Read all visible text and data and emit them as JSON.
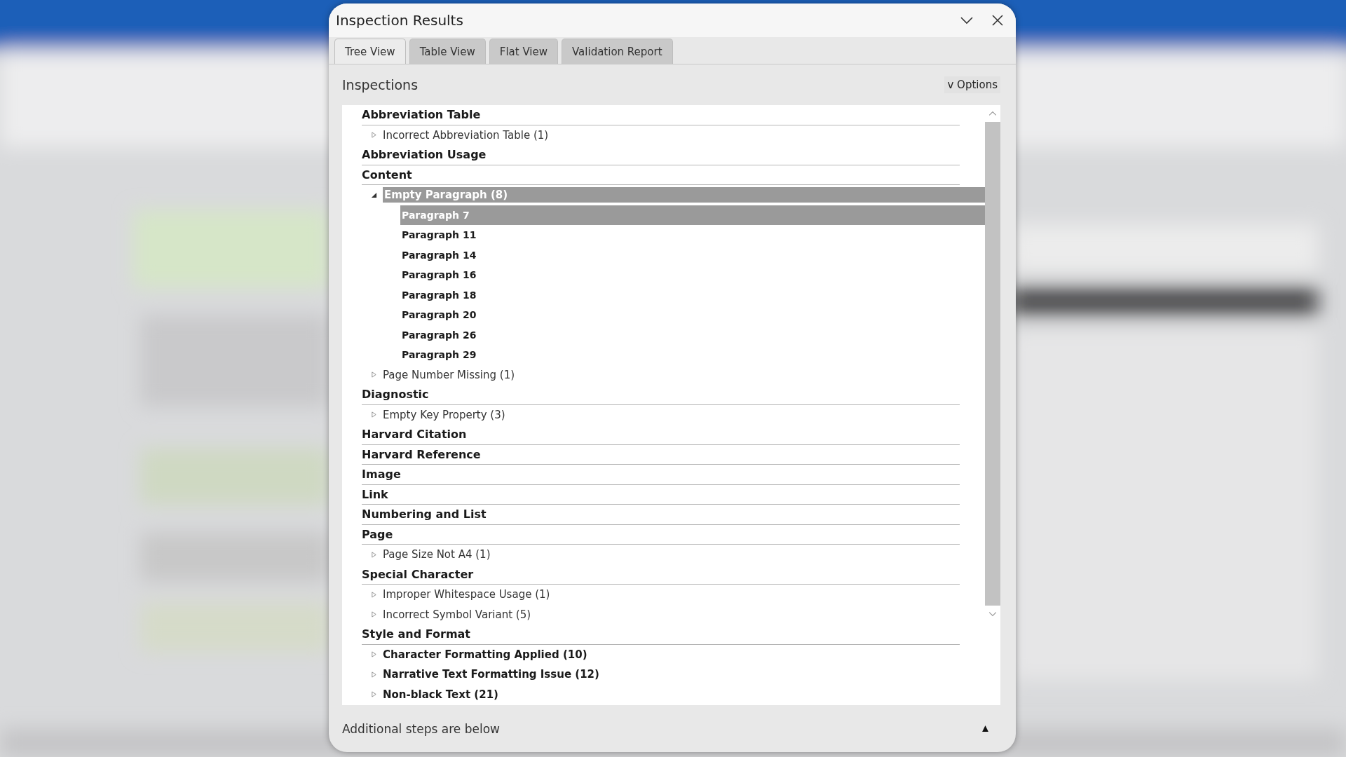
{
  "window": {
    "title": "Inspection Results"
  },
  "tabs": [
    {
      "label": "Tree View",
      "selected": true
    },
    {
      "label": "Table View",
      "selected": false
    },
    {
      "label": "Flat View",
      "selected": false
    },
    {
      "label": "Validation Report",
      "selected": false
    }
  ],
  "panel": {
    "title": "Inspections",
    "options_button": "v Options"
  },
  "categories": [
    {
      "label": "Abbreviation Table",
      "children": [
        {
          "label": "Incorrect Abbreviation Table (1)",
          "expanded": false,
          "emphasized": false,
          "selected": false
        }
      ]
    },
    {
      "label": "Abbreviation Usage"
    },
    {
      "label": "Content",
      "children": [
        {
          "label": "Empty Paragraph (8)",
          "expanded": true,
          "emphasized": true,
          "selected": true,
          "children": [
            {
              "label": "Paragraph 7",
              "selected": true
            },
            {
              "label": "Paragraph 11",
              "selected": false
            },
            {
              "label": "Paragraph 14",
              "selected": false
            },
            {
              "label": "Paragraph 16",
              "selected": false
            },
            {
              "label": "Paragraph 18",
              "selected": false
            },
            {
              "label": "Paragraph 20",
              "selected": false
            },
            {
              "label": "Paragraph 26",
              "selected": false
            },
            {
              "label": "Paragraph 29",
              "selected": false
            }
          ]
        },
        {
          "label": "Page Number Missing (1)",
          "expanded": false,
          "emphasized": false,
          "selected": false
        }
      ]
    },
    {
      "label": "Diagnostic",
      "children": [
        {
          "label": "Empty Key Property (3)",
          "expanded": false,
          "emphasized": false,
          "selected": false
        }
      ]
    },
    {
      "label": "Harvard Citation"
    },
    {
      "label": "Harvard Reference"
    },
    {
      "label": "Image"
    },
    {
      "label": "Link"
    },
    {
      "label": "Numbering and List"
    },
    {
      "label": "Page",
      "children": [
        {
          "label": "Page Size Not A4 (1)",
          "expanded": false,
          "emphasized": false,
          "selected": false
        }
      ]
    },
    {
      "label": "Special Character",
      "children": [
        {
          "label": "Improper Whitespace Usage (1)",
          "expanded": false,
          "emphasized": false,
          "selected": false
        },
        {
          "label": "Incorrect Symbol Variant (5)",
          "expanded": false,
          "emphasized": false,
          "selected": false
        }
      ]
    },
    {
      "label": "Style and Format",
      "children": [
        {
          "label": "Character Formatting Applied (10)",
          "expanded": false,
          "emphasized": true,
          "selected": false
        },
        {
          "label": "Narrative Text Formatting Issue (12)",
          "expanded": false,
          "emphasized": true,
          "selected": false
        },
        {
          "label": "Non-black Text (21)",
          "expanded": false,
          "emphasized": true,
          "selected": false
        }
      ]
    }
  ],
  "footer": {
    "text": "Additional steps are below"
  }
}
